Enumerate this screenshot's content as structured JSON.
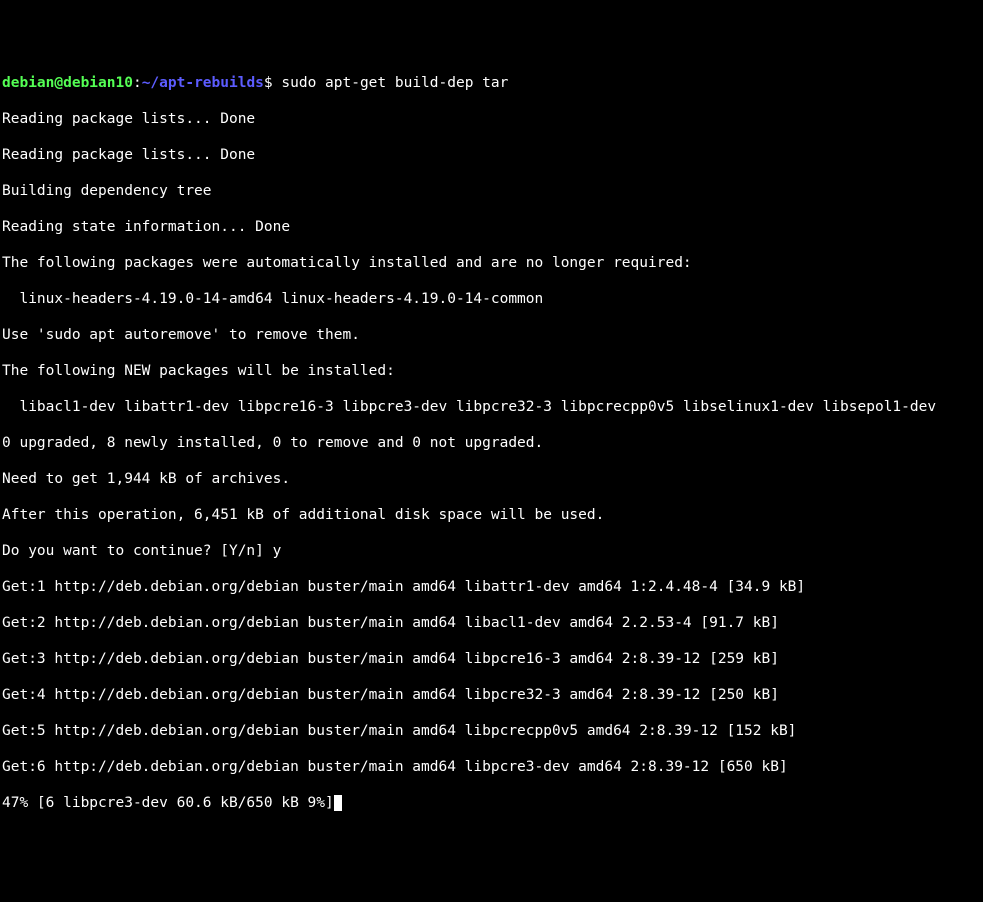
{
  "prompt": {
    "user_host": "debian@debian10",
    "colon": ":",
    "path": "~/apt-rebuilds",
    "suffix": "$ "
  },
  "command": "sudo apt-get build-dep tar",
  "lines": [
    "Reading package lists... Done",
    "Reading package lists... Done",
    "Building dependency tree",
    "Reading state information... Done",
    "The following packages were automatically installed and are no longer required:",
    "  linux-headers-4.19.0-14-amd64 linux-headers-4.19.0-14-common",
    "Use 'sudo apt autoremove' to remove them.",
    "The following NEW packages will be installed:",
    "  libacl1-dev libattr1-dev libpcre16-3 libpcre3-dev libpcre32-3 libpcrecpp0v5 libselinux1-dev libsepol1-dev",
    "0 upgraded, 8 newly installed, 0 to remove and 0 not upgraded.",
    "Need to get 1,944 kB of archives.",
    "After this operation, 6,451 kB of additional disk space will be used.",
    "Do you want to continue? [Y/n] y",
    "Get:1 http://deb.debian.org/debian buster/main amd64 libattr1-dev amd64 1:2.4.48-4 [34.9 kB]",
    "Get:2 http://deb.debian.org/debian buster/main amd64 libacl1-dev amd64 2.2.53-4 [91.7 kB]",
    "Get:3 http://deb.debian.org/debian buster/main amd64 libpcre16-3 amd64 2:8.39-12 [259 kB]",
    "Get:4 http://deb.debian.org/debian buster/main amd64 libpcre32-3 amd64 2:8.39-12 [250 kB]",
    "Get:5 http://deb.debian.org/debian buster/main amd64 libpcrecpp0v5 amd64 2:8.39-12 [152 kB]",
    "Get:6 http://deb.debian.org/debian buster/main amd64 libpcre3-dev amd64 2:8.39-12 [650 kB]",
    "47% [6 libpcre3-dev 60.6 kB/650 kB 9%]"
  ]
}
